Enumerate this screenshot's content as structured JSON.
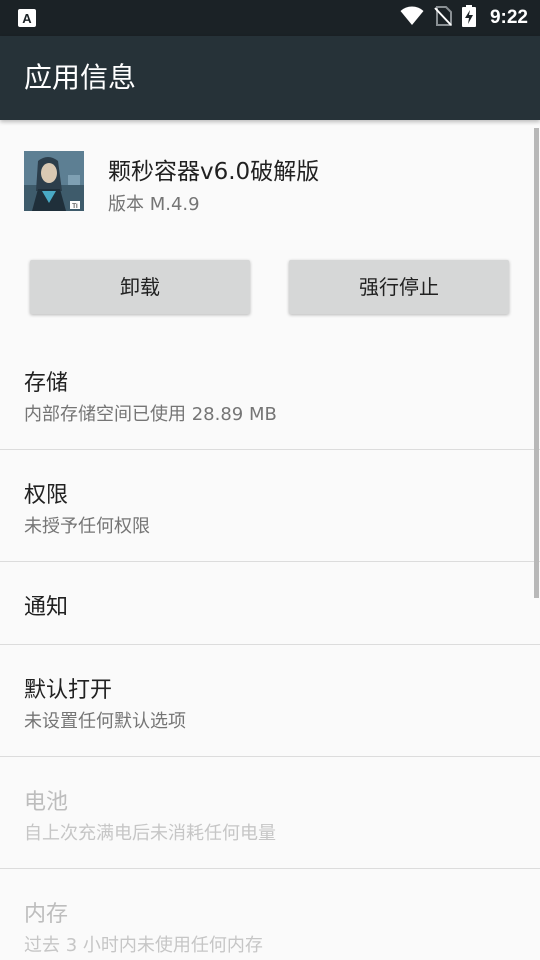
{
  "status_bar": {
    "notification_icon": "app-notification-icon",
    "icons": [
      "wifi-icon",
      "no-sim-icon",
      "battery-charging-icon"
    ],
    "time": "9:22"
  },
  "app_bar": {
    "title": "应用信息"
  },
  "app": {
    "icon": "app-icon",
    "name": "颗秒容器v6.0破解版",
    "version": "版本 M.4.9"
  },
  "buttons": {
    "uninstall": "卸载",
    "force_stop": "强行停止"
  },
  "preferences": [
    {
      "title": "存储",
      "summary": "内部存储空间已使用 28.89 MB",
      "enabled": true
    },
    {
      "title": "权限",
      "summary": "未授予任何权限",
      "enabled": true
    },
    {
      "title": "通知",
      "summary": "",
      "enabled": true
    },
    {
      "title": "默认打开",
      "summary": "未设置任何默认选项",
      "enabled": true
    },
    {
      "title": "电池",
      "summary": "自上次充满电后未消耗任何电量",
      "enabled": false
    },
    {
      "title": "内存",
      "summary": "过去 3 小时内未使用任何内存",
      "enabled": false
    }
  ],
  "colors": {
    "status_bar": "#1b2226",
    "app_bar": "#263238",
    "background": "#fafafa",
    "button": "#d6d7d7",
    "primary_text": "#212121",
    "secondary_text": "#757575",
    "disabled_text": "#bdbdbd"
  }
}
